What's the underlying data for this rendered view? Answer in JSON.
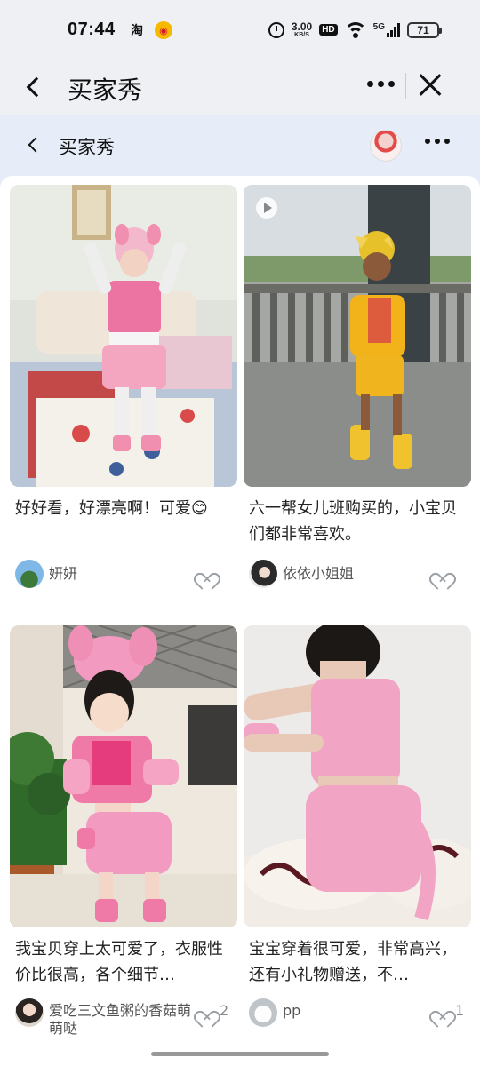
{
  "status_bar": {
    "time": "07:44",
    "app_icons": [
      "taobao-icon",
      "weibo-icon"
    ],
    "net_speed": "3.00",
    "net_speed_unit": "KB/S",
    "hd_label": "HD",
    "signal_label": "5G",
    "battery": "71"
  },
  "navbar": {
    "title": "买家秀"
  },
  "subheader": {
    "title": "买家秀"
  },
  "posts": [
    {
      "text": "好好看，好漂亮啊！可爱😊",
      "user": "妍妍",
      "likes": "",
      "has_video": false
    },
    {
      "text": "六一帮女儿班购买的，小宝贝们都非常喜欢。",
      "user": "依依小姐姐",
      "likes": "",
      "has_video": true
    },
    {
      "text": "我宝贝穿上太可爱了，衣服性价比很高，各个细节…",
      "user": "爱吃三文鱼粥的香菇萌萌哒",
      "likes": "2",
      "has_video": false
    },
    {
      "text": "宝宝穿着很可爱，非常高兴，还有小礼物赠送，不…",
      "user": "pp",
      "likes": "1",
      "has_video": false
    }
  ]
}
